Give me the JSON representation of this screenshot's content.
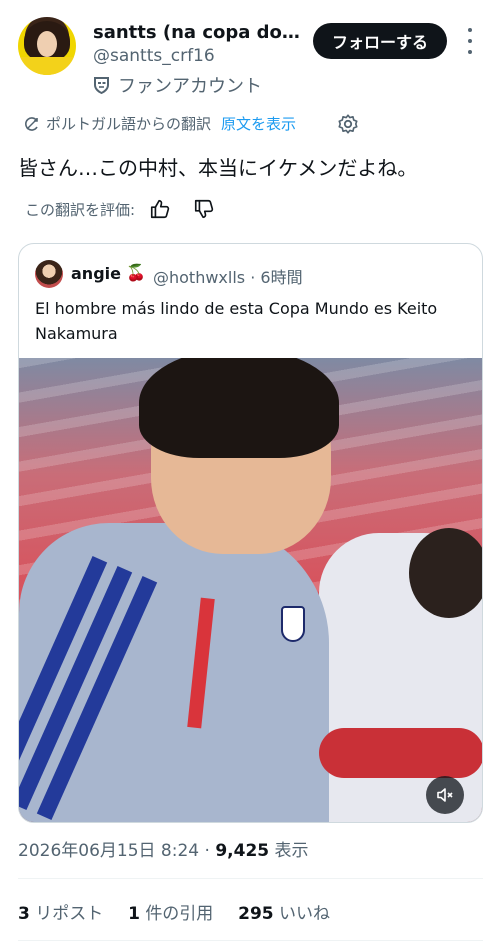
{
  "author": {
    "display_name": "santts (na copa do m...",
    "handle": "@santts_crf16",
    "fan_label": "ファンアカウント",
    "follow_label": "フォローする"
  },
  "translation": {
    "source_label": "ポルトガル語からの翻訳",
    "show_original_label": "原文を表示",
    "translated_text": "皆さん…この中村、本当にイケメンだよね。",
    "rate_label": "この翻訳を評価:"
  },
  "quote": {
    "name": "angie",
    "emoji": "🍒",
    "handle": "@hothwxlls",
    "time": "· 6時間",
    "text": "El hombre más lindo de esta Copa Mundo es Keito Nakamura"
  },
  "meta": {
    "timestamp": "2026年06月15日 8:24 ·",
    "views_count": "9,425",
    "views_label": "表示"
  },
  "stats": {
    "reposts_count": "3",
    "reposts_label": "リポスト",
    "quotes_count": "1",
    "quotes_label": "件の引用",
    "likes_count": "295",
    "likes_label": "いいね"
  },
  "icons": {
    "more": "more-icon",
    "fan": "mask-icon",
    "translate": "translate-icon",
    "settings": "gear-icon",
    "like_translation": "thumbs-up-icon",
    "dislike_translation": "thumbs-down-icon",
    "mute": "mute-icon"
  },
  "colors": {
    "accent": "#1d9bf0",
    "text_primary": "#0f1419",
    "text_secondary": "#536471",
    "follow_bg": "#0f1419"
  }
}
